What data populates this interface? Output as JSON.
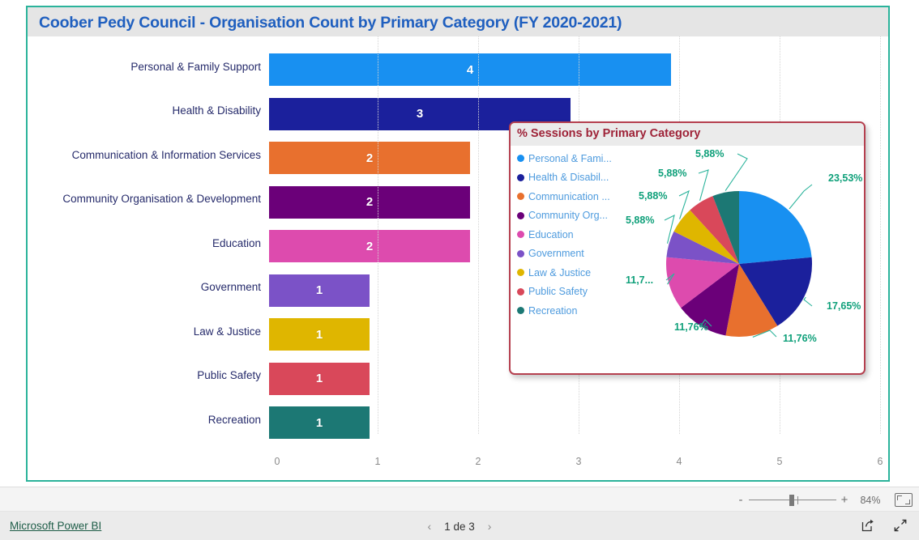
{
  "report": {
    "title": "Coober Pedy Council - Organisation Count by Primary Category (FY 2020-2021)",
    "frame_accent_color": "#2BB39B",
    "title_color": "#1F5FBF"
  },
  "chart_data": [
    {
      "type": "bar",
      "orientation": "horizontal",
      "title": "Coober Pedy Council - Organisation Count by Primary Category (FY 2020-2021)",
      "xlabel": "",
      "ylabel": "",
      "xlim": [
        0,
        6
      ],
      "xticks": [
        "0",
        "1",
        "2",
        "3",
        "4",
        "5",
        "6"
      ],
      "grid": true,
      "categories": [
        "Personal & Family Support",
        "Health & Disability",
        "Communication & Information Services",
        "Community Organisation & Development",
        "Education",
        "Government",
        "Law & Justice",
        "Public Safety",
        "Recreation"
      ],
      "values": [
        4,
        3,
        2,
        2,
        2,
        1,
        1,
        1,
        1
      ],
      "value_labels": [
        "4",
        "3",
        "2",
        "2",
        "2",
        "1",
        "1",
        "1",
        "1"
      ],
      "colors": [
        "#1890F1",
        "#1B209C",
        "#E8702E",
        "#6B0079",
        "#DD4BAE",
        "#7B52C7",
        "#DFB600",
        "#D9485A",
        "#1C7874"
      ]
    },
    {
      "type": "pie",
      "title": "% Sessions by Primary Category",
      "legend_position": "left",
      "labels": [
        "Personal & Family Support",
        "Health & Disability",
        "Communication & Information Services",
        "Community Organisation & Development",
        "Education",
        "Government",
        "Law & Justice",
        "Public Safety",
        "Recreation"
      ],
      "legend_labels": [
        "Personal & Fami...",
        "Health & Disabil...",
        "Communication ...",
        "Community Org...",
        "Education",
        "Government",
        "Law & Justice",
        "Public Safety",
        "Recreation"
      ],
      "values": [
        23.53,
        17.65,
        11.76,
        11.76,
        11.76,
        5.88,
        5.88,
        5.88,
        5.88
      ],
      "data_labels": [
        "23,53%",
        "17,65%",
        "11,76%",
        "11,76%",
        "11,7...",
        "5,88%",
        "5,88%",
        "5,88%",
        "5,88%"
      ],
      "colors": [
        "#1890F1",
        "#1B209C",
        "#E8702E",
        "#6B0079",
        "#DD4BAE",
        "#7B52C7",
        "#DFB600",
        "#D9485A",
        "#1C7874"
      ],
      "panel_border_color": "#B5404F",
      "title_color": "#9E2237",
      "legend_text_color": "#4E9BDE",
      "data_label_color": "#0FA07A"
    }
  ],
  "zoom_bar": {
    "minus_label": "-",
    "plus_label": "+",
    "zoom_level": "84%",
    "fit_icon": "fit-to-page-icon"
  },
  "status_bar": {
    "brand_link": "Microsoft Power BI",
    "prev_arrow": "‹",
    "next_arrow": "›",
    "page_label": "1 de 3",
    "share_icon": "share-icon",
    "fullscreen_icon": "fullscreen-icon"
  }
}
